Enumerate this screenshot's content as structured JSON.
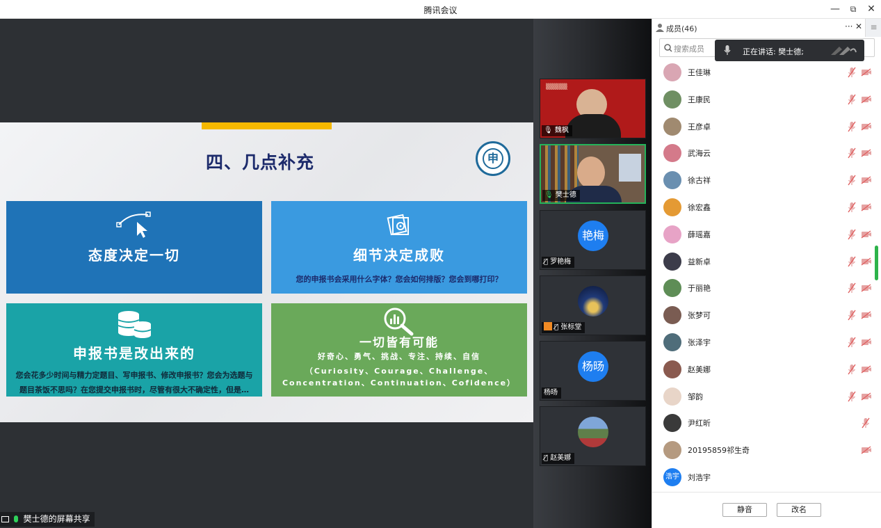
{
  "window": {
    "title": "腾讯会议",
    "minimize": "—",
    "restore": "⧉",
    "close": "✕"
  },
  "slide": {
    "title": "四、几点补充",
    "boxes": [
      {
        "title": "态度决定一切",
        "icon": "cursor-path-icon",
        "color": "#1f73b7"
      },
      {
        "title": "细节决定成败",
        "subtitle": "您的申报书会采用什么字体？您会如何排版？您会到哪打印？",
        "icon": "settings-document-icon",
        "color": "#3a9ae0"
      },
      {
        "title": "申报书是改出来的",
        "subtitle_lines": [
          "您会花多少时间与精力定题目、写申报书、修改申报书？您会为选题与",
          "题目茶饭不思吗？在您提交申报书时，尽管有很大不确定性，但是…"
        ],
        "icon": "coin-stack-icon",
        "color": "#1aa3a7"
      },
      {
        "title": "一切皆有可能",
        "subtitle_lines": [
          "好奇心、勇气、挑战、专注、持续、自信",
          "（Curiosity、Courage、Challenge、",
          "Concentration、Continuation、Cofidence）"
        ],
        "icon": "magnify-chart-icon",
        "color": "#6aa95a"
      }
    ]
  },
  "share_label": "樊士德的屏幕共享",
  "video_tiles": [
    {
      "name": "魏枫",
      "kind": "video"
    },
    {
      "name": "樊士德",
      "kind": "video",
      "active": true
    },
    {
      "name": "罗艳梅",
      "kind": "avatar",
      "avatar_text": "艳梅"
    },
    {
      "name": "张标堂",
      "kind": "image"
    },
    {
      "name": "杨旸",
      "kind": "avatar",
      "avatar_text": "杨旸"
    },
    {
      "name": "赵美娜",
      "kind": "image"
    }
  ],
  "panel": {
    "title": "成员(46)",
    "more": "···",
    "close": "✕",
    "search_placeholder": "搜索成员",
    "speaking": "正在讲话: 樊士德;",
    "members": [
      {
        "name": "王佳琳",
        "avatar_color": "#d9a6b3"
      },
      {
        "name": "王康民",
        "avatar_color": "#6f8f63"
      },
      {
        "name": "王彦卓",
        "avatar_color": "#a08a70"
      },
      {
        "name": "武海云",
        "avatar_color": "#d47a8a"
      },
      {
        "name": "徐古祥",
        "avatar_color": "#6a8fb0"
      },
      {
        "name": "徐宏鑫",
        "avatar_color": "#e49a34"
      },
      {
        "name": "薛瑶嘉",
        "avatar_color": "#e7a3c6"
      },
      {
        "name": "益新卓",
        "avatar_color": "#3c3c4a"
      },
      {
        "name": "于丽艳",
        "avatar_color": "#5e8d56"
      },
      {
        "name": "张梦可",
        "avatar_color": "#7a5c52"
      },
      {
        "name": "张泽宇",
        "avatar_color": "#4f6d7a"
      },
      {
        "name": "赵美娜",
        "avatar_color": "#8a5a4f"
      },
      {
        "name": "邹韵",
        "avatar_color": "#e8d5c8"
      },
      {
        "name": "尹红昕",
        "avatar_color": "#3a3a3a"
      },
      {
        "name": "20195859祁生奇",
        "avatar_color": "#b59a80"
      },
      {
        "name": "刘浩宇",
        "avatar_color": "#1e7ef0",
        "avatar_text": "浩宇"
      }
    ],
    "mute_button": "静音",
    "rename_button": "改名"
  }
}
